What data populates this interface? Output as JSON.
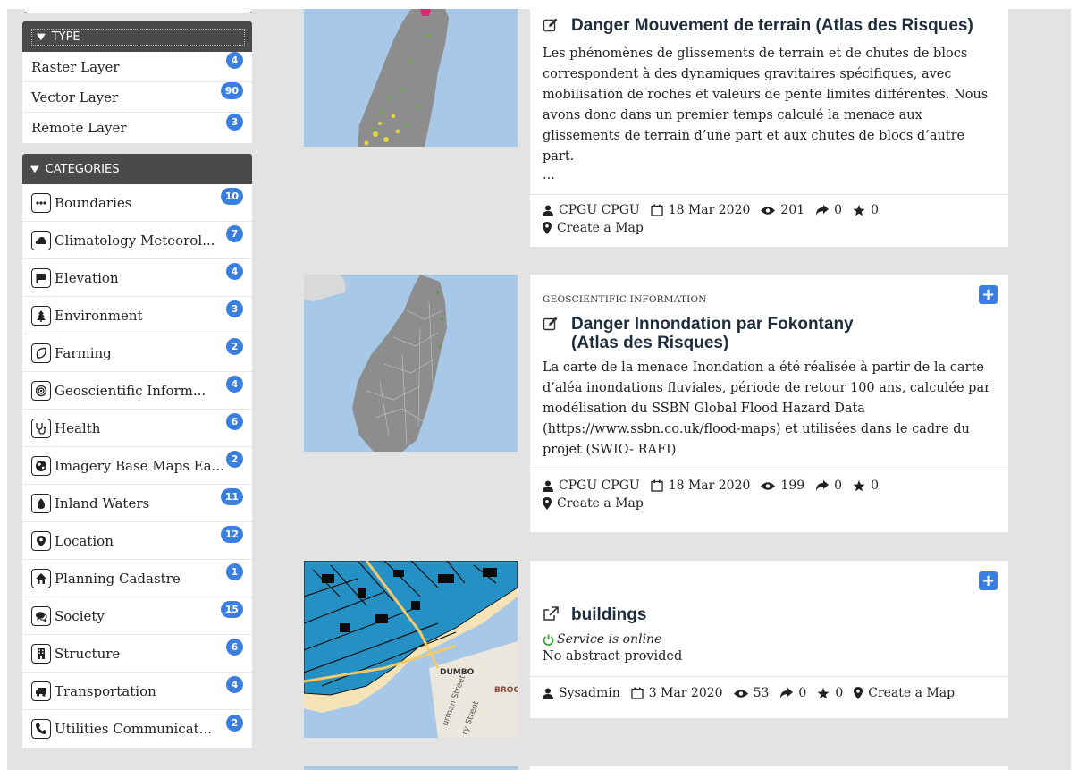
{
  "sidebar": {
    "type_header": "TYPE",
    "type_items": [
      {
        "label": "Raster Layer",
        "count": "4"
      },
      {
        "label": "Vector Layer",
        "count": "90"
      },
      {
        "label": "Remote Layer",
        "count": "3"
      }
    ],
    "categories_header": "CATEGORIES",
    "category_items": [
      {
        "label": "Boundaries",
        "count": "10",
        "icon": "ellipsis-icon"
      },
      {
        "label": "Climatology Meteorol...",
        "count": "7",
        "icon": "cloud-icon"
      },
      {
        "label": "Elevation",
        "count": "4",
        "icon": "flag-icon"
      },
      {
        "label": "Environment",
        "count": "3",
        "icon": "tree-icon"
      },
      {
        "label": "Farming",
        "count": "2",
        "icon": "leaf-icon"
      },
      {
        "label": "Geoscientific Inform...",
        "count": "4",
        "icon": "target-icon"
      },
      {
        "label": "Health",
        "count": "6",
        "icon": "stethoscope-icon"
      },
      {
        "label": "Imagery Base Maps Ea...",
        "count": "2",
        "icon": "globe-icon"
      },
      {
        "label": "Inland Waters",
        "count": "11",
        "icon": "water-drop-icon"
      },
      {
        "label": "Location",
        "count": "12",
        "icon": "map-marker-icon"
      },
      {
        "label": "Planning Cadastre",
        "count": "1",
        "icon": "home-icon"
      },
      {
        "label": "Society",
        "count": "15",
        "icon": "comments-icon"
      },
      {
        "label": "Structure",
        "count": "6",
        "icon": "building-icon"
      },
      {
        "label": "Transportation",
        "count": "4",
        "icon": "truck-icon"
      },
      {
        "label": "Utilities Communicat...",
        "count": "2",
        "icon": "phone-icon"
      }
    ]
  },
  "cards": [
    {
      "title": "Danger Mouvement de terrain (Atlas des Risques)",
      "abstract": "Les phénomènes de glissements de terrain et de chutes de blocs correspondent à des dynamiques gravitaires spécifiques, avec mobilisation de roches et valeurs de pente limites différentes. Nous avons donc dans un premier temps calculé la menace aux glissements de terrain d’une part et aux chutes de blocs d’autre part.",
      "ellipsis": "...",
      "owner": "CPGU CPGU",
      "date": "18 Mar 2020",
      "views": "201",
      "shares": "0",
      "rating": "0",
      "create_map": "Create a Map"
    },
    {
      "category": "GEOSCIENTIFIC INFORMATION",
      "title": "Danger Innondation par Fokontany (Atlas des Risques)",
      "abstract": "La carte de la menace Inondation a été réalisée à partir de la carte d’aléa inondations fluviales, période de retour 100 ans, calculée par modélisation du SSBN Global Flood Hazard Data (https://www.ssbn.co.uk/flood-maps) et utilisées dans le cadre du projet (SWIO- RAFI)",
      "owner": "CPGU CPGU",
      "date": "18 Mar 2020",
      "views": "199",
      "shares": "0",
      "rating": "0",
      "create_map": "Create a Map"
    },
    {
      "title": "buildings",
      "status": "Service is online",
      "abstract": "No abstract provided",
      "owner": "Sysadmin",
      "date": "3 Mar 2020",
      "views": "53",
      "shares": "0",
      "rating": "0",
      "create_map": "Create a Map"
    }
  ],
  "map_labels": {
    "dumbo": "DUMBO",
    "broc": "BROC",
    "street1": "urman Street",
    "street2": "ry Street"
  },
  "colors": {
    "accent": "#3a7fe0",
    "header_bg": "#4a4a4a",
    "page_bg": "#e3e3e3",
    "online": "#3aa53a"
  }
}
